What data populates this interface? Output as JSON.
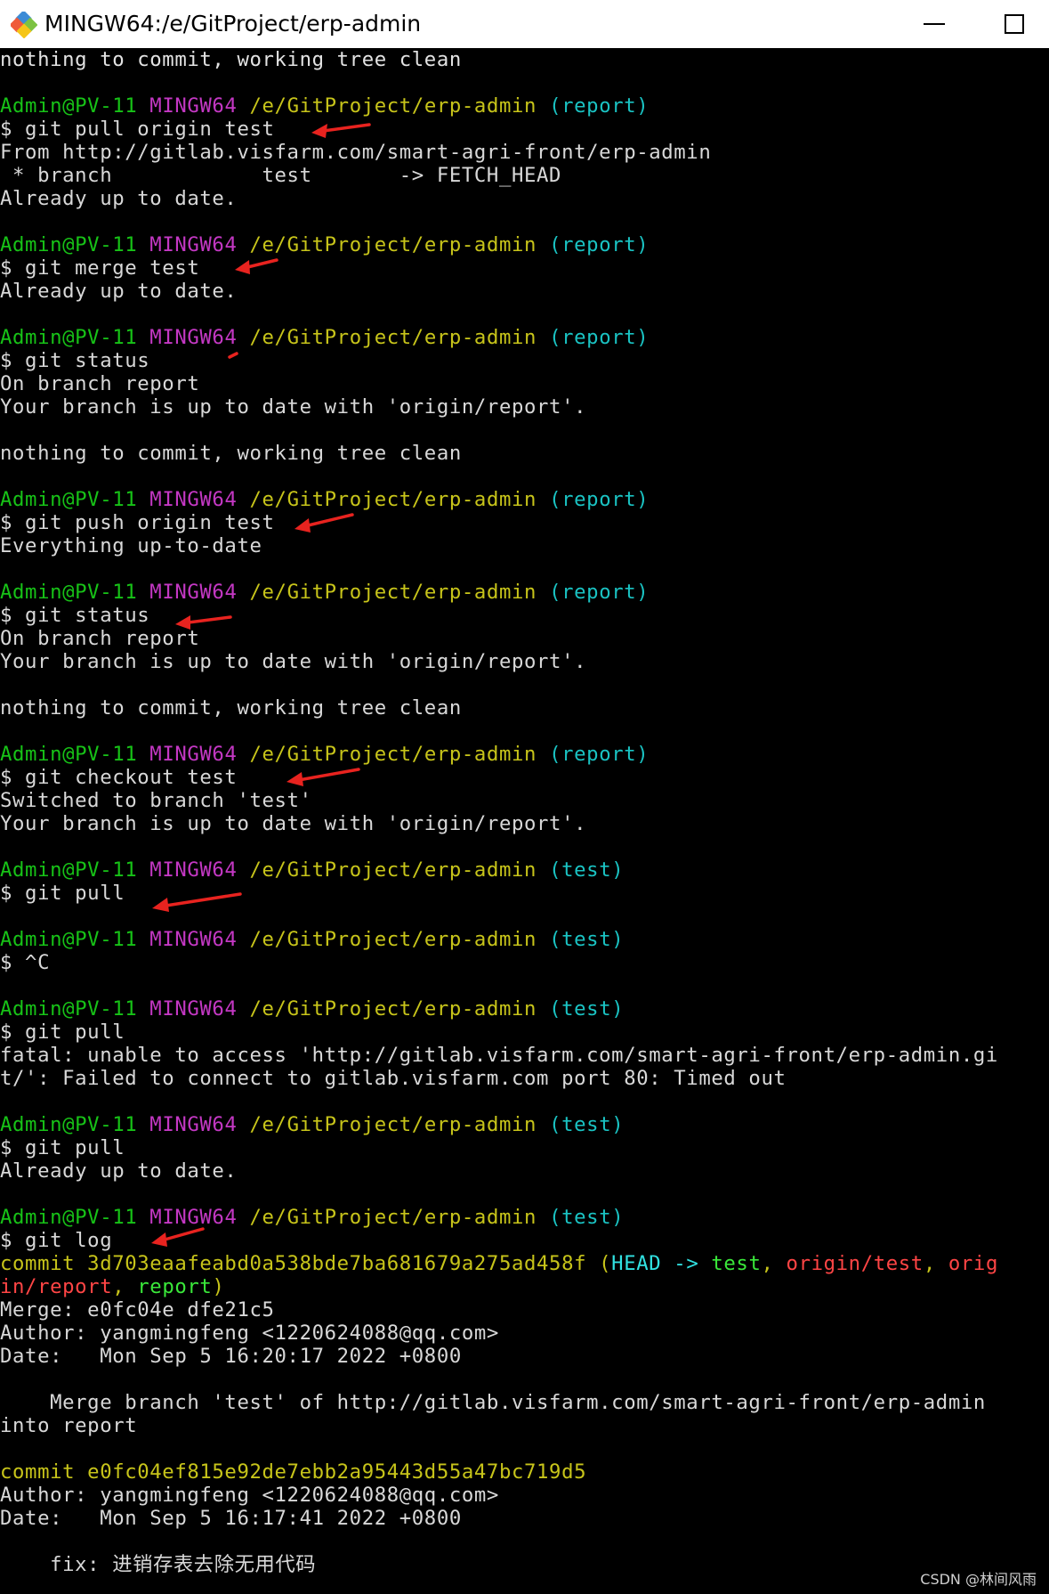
{
  "window": {
    "title": "MINGW64:/e/GitProject/erp-admin",
    "icon": "git-bash-icon",
    "minimize_icon": "minimize-icon",
    "maximize_icon": "maximize-icon"
  },
  "colors": {
    "background": "#000000",
    "prompt_user": "#17c217",
    "prompt_env": "#c438c4",
    "prompt_path": "#c7c41a",
    "prompt_branch": "#1ac3c3",
    "annotation_arrow": "#e8231f"
  },
  "terminal": {
    "lines": [
      [
        {
          "t": "nothing to commit, working tree clean",
          "c": "white"
        }
      ],
      [],
      [
        {
          "t": "Admin@PV-11",
          "c": "green"
        },
        {
          "t": " "
        },
        {
          "t": "MINGW64",
          "c": "magenta"
        },
        {
          "t": " "
        },
        {
          "t": "/e/GitProject/erp-admin",
          "c": "yellow"
        },
        {
          "t": " "
        },
        {
          "t": "(report)",
          "c": "cyan"
        }
      ],
      [
        {
          "t": "$ git pull origin test"
        }
      ],
      [
        {
          "t": "From http://gitlab.visfarm.com/smart-agri-front/erp-admin"
        }
      ],
      [
        {
          "t": " * branch            test       -> FETCH_HEAD"
        }
      ],
      [
        {
          "t": "Already up to date."
        }
      ],
      [],
      [
        {
          "t": "Admin@PV-11",
          "c": "green"
        },
        {
          "t": " "
        },
        {
          "t": "MINGW64",
          "c": "magenta"
        },
        {
          "t": " "
        },
        {
          "t": "/e/GitProject/erp-admin",
          "c": "yellow"
        },
        {
          "t": " "
        },
        {
          "t": "(report)",
          "c": "cyan"
        }
      ],
      [
        {
          "t": "$ git merge test"
        }
      ],
      [
        {
          "t": "Already up to date."
        }
      ],
      [],
      [
        {
          "t": "Admin@PV-11",
          "c": "green"
        },
        {
          "t": " "
        },
        {
          "t": "MINGW64",
          "c": "magenta"
        },
        {
          "t": " "
        },
        {
          "t": "/e/GitProject/erp-admin",
          "c": "yellow"
        },
        {
          "t": " "
        },
        {
          "t": "(report)",
          "c": "cyan"
        }
      ],
      [
        {
          "t": "$ git status"
        }
      ],
      [
        {
          "t": "On branch report"
        }
      ],
      [
        {
          "t": "Your branch is up to date with 'origin/report'."
        }
      ],
      [],
      [
        {
          "t": "nothing to commit, working tree clean"
        }
      ],
      [],
      [
        {
          "t": "Admin@PV-11",
          "c": "green"
        },
        {
          "t": " "
        },
        {
          "t": "MINGW64",
          "c": "magenta"
        },
        {
          "t": " "
        },
        {
          "t": "/e/GitProject/erp-admin",
          "c": "yellow"
        },
        {
          "t": " "
        },
        {
          "t": "(report)",
          "c": "cyan"
        }
      ],
      [
        {
          "t": "$ git push origin test"
        }
      ],
      [
        {
          "t": "Everything up-to-date"
        }
      ],
      [],
      [
        {
          "t": "Admin@PV-11",
          "c": "green"
        },
        {
          "t": " "
        },
        {
          "t": "MINGW64",
          "c": "magenta"
        },
        {
          "t": " "
        },
        {
          "t": "/e/GitProject/erp-admin",
          "c": "yellow"
        },
        {
          "t": " "
        },
        {
          "t": "(report)",
          "c": "cyan"
        }
      ],
      [
        {
          "t": "$ git status"
        }
      ],
      [
        {
          "t": "On branch report"
        }
      ],
      [
        {
          "t": "Your branch is up to date with 'origin/report'."
        }
      ],
      [],
      [
        {
          "t": "nothing to commit, working tree clean"
        }
      ],
      [],
      [
        {
          "t": "Admin@PV-11",
          "c": "green"
        },
        {
          "t": " "
        },
        {
          "t": "MINGW64",
          "c": "magenta"
        },
        {
          "t": " "
        },
        {
          "t": "/e/GitProject/erp-admin",
          "c": "yellow"
        },
        {
          "t": " "
        },
        {
          "t": "(report)",
          "c": "cyan"
        }
      ],
      [
        {
          "t": "$ git checkout test"
        }
      ],
      [
        {
          "t": "Switched to branch 'test'"
        }
      ],
      [
        {
          "t": "Your branch is up to date with 'origin/report'."
        }
      ],
      [],
      [
        {
          "t": "Admin@PV-11",
          "c": "green"
        },
        {
          "t": " "
        },
        {
          "t": "MINGW64",
          "c": "magenta"
        },
        {
          "t": " "
        },
        {
          "t": "/e/GitProject/erp-admin",
          "c": "yellow"
        },
        {
          "t": " "
        },
        {
          "t": "(test)",
          "c": "cyan"
        }
      ],
      [
        {
          "t": "$ git pull"
        }
      ],
      [],
      [
        {
          "t": "Admin@PV-11",
          "c": "green"
        },
        {
          "t": " "
        },
        {
          "t": "MINGW64",
          "c": "magenta"
        },
        {
          "t": " "
        },
        {
          "t": "/e/GitProject/erp-admin",
          "c": "yellow"
        },
        {
          "t": " "
        },
        {
          "t": "(test)",
          "c": "cyan"
        }
      ],
      [
        {
          "t": "$ ^C"
        }
      ],
      [],
      [
        {
          "t": "Admin@PV-11",
          "c": "green"
        },
        {
          "t": " "
        },
        {
          "t": "MINGW64",
          "c": "magenta"
        },
        {
          "t": " "
        },
        {
          "t": "/e/GitProject/erp-admin",
          "c": "yellow"
        },
        {
          "t": " "
        },
        {
          "t": "(test)",
          "c": "cyan"
        }
      ],
      [
        {
          "t": "$ git pull"
        }
      ],
      [
        {
          "t": "fatal: unable to access 'http://gitlab.visfarm.com/smart-agri-front/erp-admin.gi"
        }
      ],
      [
        {
          "t": "t/': Failed to connect to gitlab.visfarm.com port 80: Timed out"
        }
      ],
      [],
      [
        {
          "t": "Admin@PV-11",
          "c": "green"
        },
        {
          "t": " "
        },
        {
          "t": "MINGW64",
          "c": "magenta"
        },
        {
          "t": " "
        },
        {
          "t": "/e/GitProject/erp-admin",
          "c": "yellow"
        },
        {
          "t": " "
        },
        {
          "t": "(test)",
          "c": "cyan"
        }
      ],
      [
        {
          "t": "$ git pull"
        }
      ],
      [
        {
          "t": "Already up to date."
        }
      ],
      [],
      [
        {
          "t": "Admin@PV-11",
          "c": "green"
        },
        {
          "t": " "
        },
        {
          "t": "MINGW64",
          "c": "magenta"
        },
        {
          "t": " "
        },
        {
          "t": "/e/GitProject/erp-admin",
          "c": "yellow"
        },
        {
          "t": " "
        },
        {
          "t": "(test)",
          "c": "cyan"
        }
      ],
      [
        {
          "t": "$ git log"
        }
      ],
      [
        {
          "t": "commit 3d703eaafeabd0a538bde7ba681679a275ad458f (",
          "c": "yellow"
        },
        {
          "t": "HEAD -> ",
          "c": "lcyan"
        },
        {
          "t": "test",
          "c": "lgreen"
        },
        {
          "t": ", ",
          "c": "yellow"
        },
        {
          "t": "origin/test",
          "c": "red"
        },
        {
          "t": ", ",
          "c": "yellow"
        },
        {
          "t": "orig",
          "c": "red"
        }
      ],
      [
        {
          "t": "in/report",
          "c": "red"
        },
        {
          "t": ", ",
          "c": "yellow"
        },
        {
          "t": "report",
          "c": "lgreen"
        },
        {
          "t": ")",
          "c": "yellow"
        }
      ],
      [
        {
          "t": "Merge: e0fc04e dfe21c5"
        }
      ],
      [
        {
          "t": "Author: yangmingfeng <1220624088@qq.com>"
        }
      ],
      [
        {
          "t": "Date:   Mon Sep 5 16:20:17 2022 +0800"
        }
      ],
      [],
      [
        {
          "t": "    Merge branch 'test' of http://gitlab.visfarm.com/smart-agri-front/erp-admin"
        }
      ],
      [
        {
          "t": "into report"
        }
      ],
      [],
      [
        {
          "t": "commit e0fc04ef815e92de7ebb2a95443d55a47bc719d5",
          "c": "yellow"
        }
      ],
      [
        {
          "t": "Author: yangmingfeng <1220624088@qq.com>"
        }
      ],
      [
        {
          "t": "Date:   Mon Sep 5 16:17:41 2022 +0800"
        }
      ],
      [],
      [
        {
          "t": "    fix: 进销存表去除无用代码"
        }
      ]
    ]
  },
  "watermark": "CSDN @林间风雨"
}
